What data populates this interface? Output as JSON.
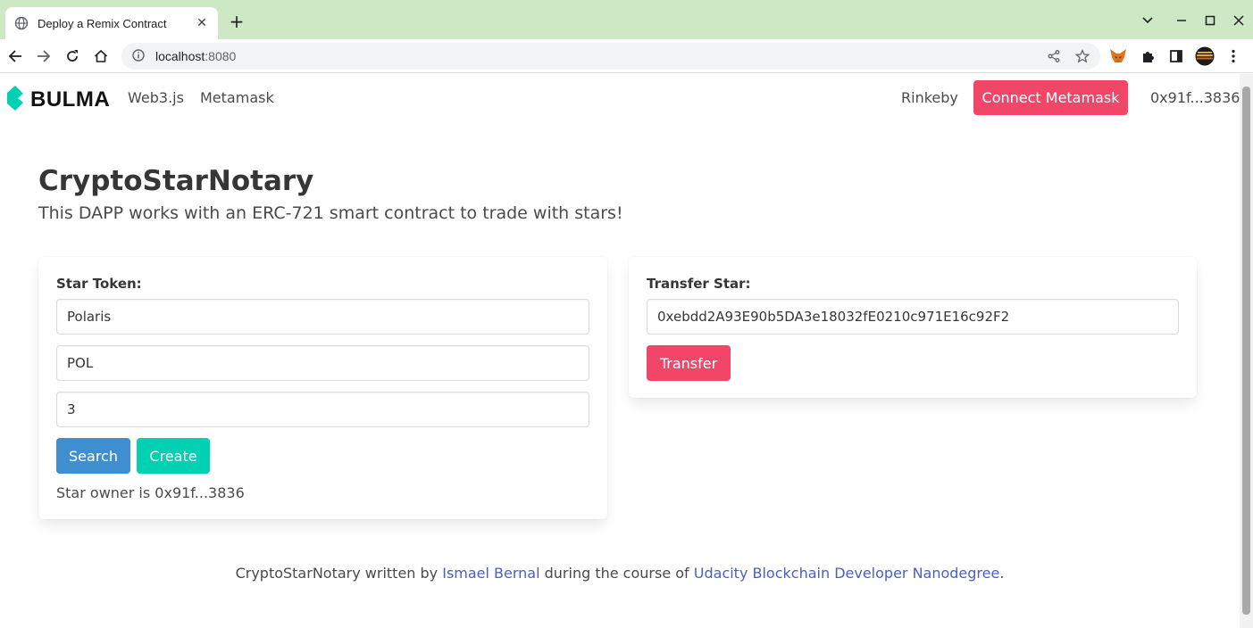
{
  "browser": {
    "tab_title": "Deploy a Remix Contract",
    "url_host": "localhost",
    "url_port": ":8080"
  },
  "navbar": {
    "brand": "BULMA",
    "links": [
      "Web3.js",
      "Metamask"
    ],
    "network": "Rinkeby",
    "connect_label": "Connect Metamask",
    "account": "0x91f...3836"
  },
  "hero": {
    "title": "CryptoStarNotary",
    "subtitle": "This DAPP works with an ERC-721 smart contract to trade with stars!"
  },
  "star_token": {
    "label": "Star Token:",
    "name_value": "Polaris",
    "symbol_value": "POL",
    "id_value": "3",
    "search_label": "Search",
    "create_label": "Create",
    "owner_text": "Star owner is 0x91f...3836"
  },
  "transfer": {
    "label": "Transfer Star:",
    "address_value": "0xebdd2A93E90b5DA3e18032fE0210c971E16c92F2",
    "transfer_label": "Transfer"
  },
  "footer": {
    "prefix": "CryptoStarNotary written by ",
    "author": "Ismael Bernal",
    "middle": " during the course of ",
    "course": "Udacity Blockchain Developer Nanodegree",
    "suffix": "."
  },
  "colors": {
    "primary_danger": "#f14668",
    "info": "#3e8ed0",
    "success": "#00d1b2",
    "link": "#485fc7",
    "tabbar": "#cce8c4"
  }
}
